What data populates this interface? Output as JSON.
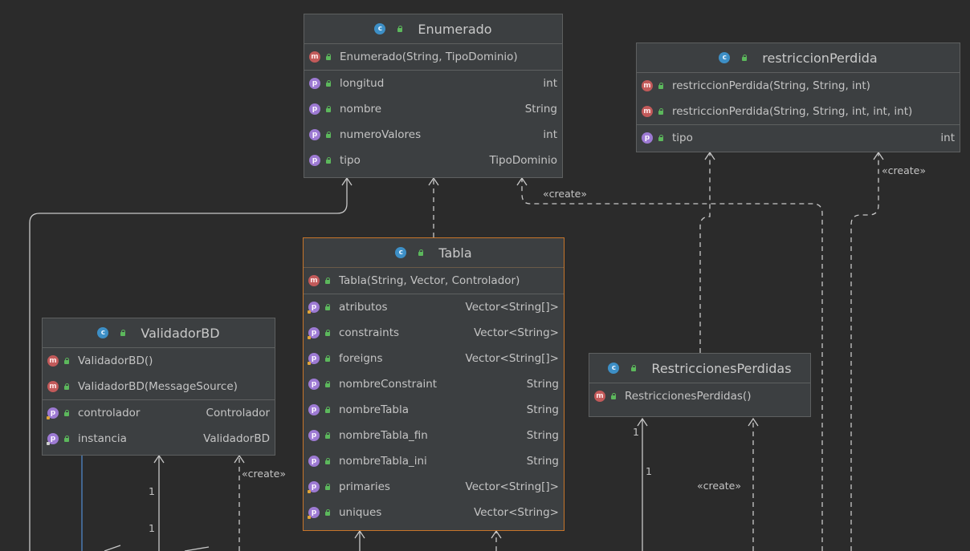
{
  "diagram": {
    "nodes": {
      "enumerado": {
        "title": "Enumerado",
        "constructors": [
          {
            "label": "Enumerado(String, TipoDominio)"
          }
        ],
        "properties": [
          {
            "name": "longitud",
            "type": "int"
          },
          {
            "name": "nombre",
            "type": "String"
          },
          {
            "name": "numeroValores",
            "type": "int"
          },
          {
            "name": "tipo",
            "type": "TipoDominio"
          }
        ]
      },
      "restriccionPerdida": {
        "title": "restriccionPerdida",
        "constructors": [
          {
            "label": "restriccionPerdida(String, String, int)"
          },
          {
            "label": "restriccionPerdida(String, String, int, int, int)"
          }
        ],
        "properties": [
          {
            "name": "tipo",
            "type": "int"
          }
        ]
      },
      "tabla": {
        "title": "Tabla",
        "constructors": [
          {
            "label": "Tabla(String, Vector, Controlador)"
          }
        ],
        "properties": [
          {
            "name": "atributos",
            "type": "Vector<String[]>"
          },
          {
            "name": "constraints",
            "type": "Vector<String>"
          },
          {
            "name": "foreigns",
            "type": "Vector<String[]>"
          },
          {
            "name": "nombreConstraint",
            "type": "String"
          },
          {
            "name": "nombreTabla",
            "type": "String"
          },
          {
            "name": "nombreTabla_fin",
            "type": "String"
          },
          {
            "name": "nombreTabla_ini",
            "type": "String"
          },
          {
            "name": "primaries",
            "type": "Vector<String[]>"
          },
          {
            "name": "uniques",
            "type": "Vector<String>"
          }
        ]
      },
      "validadorBD": {
        "title": "ValidadorBD",
        "constructors": [
          {
            "label": "ValidadorBD()"
          },
          {
            "label": "ValidadorBD(MessageSource)"
          }
        ],
        "properties": [
          {
            "name": "controlador",
            "type": "Controlador"
          },
          {
            "name": "instancia",
            "type": "ValidadorBD"
          }
        ]
      },
      "restriccionesPerdidas": {
        "title": "RestriccionesPerdidas",
        "constructors": [
          {
            "label": "RestriccionesPerdidas()"
          }
        ],
        "properties": []
      }
    },
    "edge_labels": {
      "create_enumerado": "«create»",
      "create_restriccion": "«create»",
      "create_validador": "«create»",
      "create_restricciones": "«create»",
      "mult_1a": "1",
      "mult_1b": "1",
      "mult_1c": "1",
      "mult_1d": "1"
    },
    "badges": {
      "class": "c",
      "method": "m",
      "property": "p"
    },
    "colors": {
      "background": "#2b2b2b",
      "node_fill": "#3c3f41",
      "node_border": "#5e6060",
      "selected_border": "#c7752a",
      "class_badge": "#3d8fc6",
      "method_badge": "#c25a5a",
      "property_badge": "#9d7ad3",
      "public_icon": "#5cb85c",
      "edge": "#c8c8c8",
      "blue_edge": "#4f86c6"
    }
  }
}
